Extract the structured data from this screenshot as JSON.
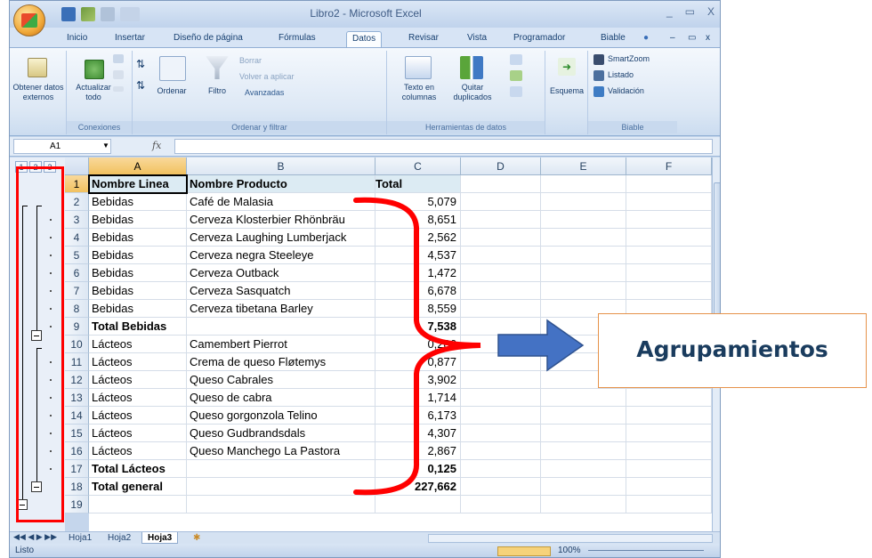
{
  "window": {
    "title": "Libro2 - Microsoft Excel",
    "controls": [
      "_",
      "▭",
      "X"
    ]
  },
  "ribbon_tabs": [
    "Inicio",
    "Insertar",
    "Diseño de página",
    "Fórmulas",
    "Datos",
    "Revisar",
    "Vista",
    "Programador",
    "Biable"
  ],
  "active_tab": "Datos",
  "ribbon": {
    "obtener_datos": "Obtener datos\nexternos",
    "actualizar": "Actualizar\ntodo",
    "ordenar": "Ordenar",
    "filtro": "Filtro",
    "borrar": "Borrar",
    "volver_aplicar": "Volver a aplicar",
    "avanzadas": "Avanzadas",
    "texto_en": "Texto en\ncolumnas",
    "quitar": "Quitar\nduplicados",
    "esquema": "Esquema",
    "smartzoom": "SmartZoom",
    "listado": "Listado",
    "validacion": "Validación",
    "group_conexiones": "Conexiones",
    "group_ordenar": "Ordenar y filtrar",
    "group_herramientas": "Herramientas de datos",
    "group_biable": "Biable"
  },
  "formula_bar": {
    "cell_ref": "A1",
    "fx": "fx",
    "value": ""
  },
  "outline_levels": [
    "1",
    "2",
    "3"
  ],
  "columns": [
    "A",
    "B",
    "C",
    "D",
    "E",
    "F"
  ],
  "rows": [
    {
      "n": "1",
      "a": "Nombre Linea",
      "b": "Nombre Producto",
      "c": "Total",
      "bold": true,
      "hdr": true
    },
    {
      "n": "2",
      "a": "Bebidas",
      "b": "Café de Malasia",
      "c": "5,079"
    },
    {
      "n": "3",
      "a": "Bebidas",
      "b": "Cerveza Klosterbier Rhönbräu",
      "c": "8,651"
    },
    {
      "n": "4",
      "a": "Bebidas",
      "b": "Cerveza Laughing Lumberjack",
      "c": "2,562"
    },
    {
      "n": "5",
      "a": "Bebidas",
      "b": "Cerveza negra Steeleye",
      "c": "4,537"
    },
    {
      "n": "6",
      "a": "Bebidas",
      "b": "Cerveza Outback",
      "c": "1,472"
    },
    {
      "n": "7",
      "a": "Bebidas",
      "b": "Cerveza Sasquatch",
      "c": "6,678"
    },
    {
      "n": "8",
      "a": "Bebidas",
      "b": "Cerveza tibetana Barley",
      "c": "8,559"
    },
    {
      "n": "9",
      "a": "Total Bebidas",
      "b": "",
      "c": "7,538",
      "bold": true
    },
    {
      "n": "10",
      "a": "Lácteos",
      "b": "Camembert Pierrot",
      "c": "0,286"
    },
    {
      "n": "11",
      "a": "Lácteos",
      "b": "Crema de queso Fløtemys",
      "c": "0,877"
    },
    {
      "n": "12",
      "a": "Lácteos",
      "b": "Queso Cabrales",
      "c": "3,902"
    },
    {
      "n": "13",
      "a": "Lácteos",
      "b": "Queso de cabra",
      "c": "1,714"
    },
    {
      "n": "14",
      "a": "Lácteos",
      "b": "Queso gorgonzola Telino",
      "c": "6,173"
    },
    {
      "n": "15",
      "a": "Lácteos",
      "b": "Queso Gudbrandsdals",
      "c": "4,307"
    },
    {
      "n": "16",
      "a": "Lácteos",
      "b": "Queso Manchego La Pastora",
      "c": "2,867"
    },
    {
      "n": "17",
      "a": "Total Lácteos",
      "b": "",
      "c": "0,125",
      "bold": true
    },
    {
      "n": "18",
      "a": "Total general",
      "b": "",
      "c": "227,662",
      "bold": true
    },
    {
      "n": "19",
      "a": "",
      "b": "",
      "c": ""
    }
  ],
  "sheets": [
    "Hoja1",
    "Hoja2",
    "Hoja3"
  ],
  "active_sheet": "Hoja3",
  "status": {
    "ready": "Listo",
    "zoom": "100%"
  },
  "annotation": {
    "label": "Agrupamientos",
    "bracket_color": "#ff0000",
    "arrow_color": "#4472c4"
  }
}
